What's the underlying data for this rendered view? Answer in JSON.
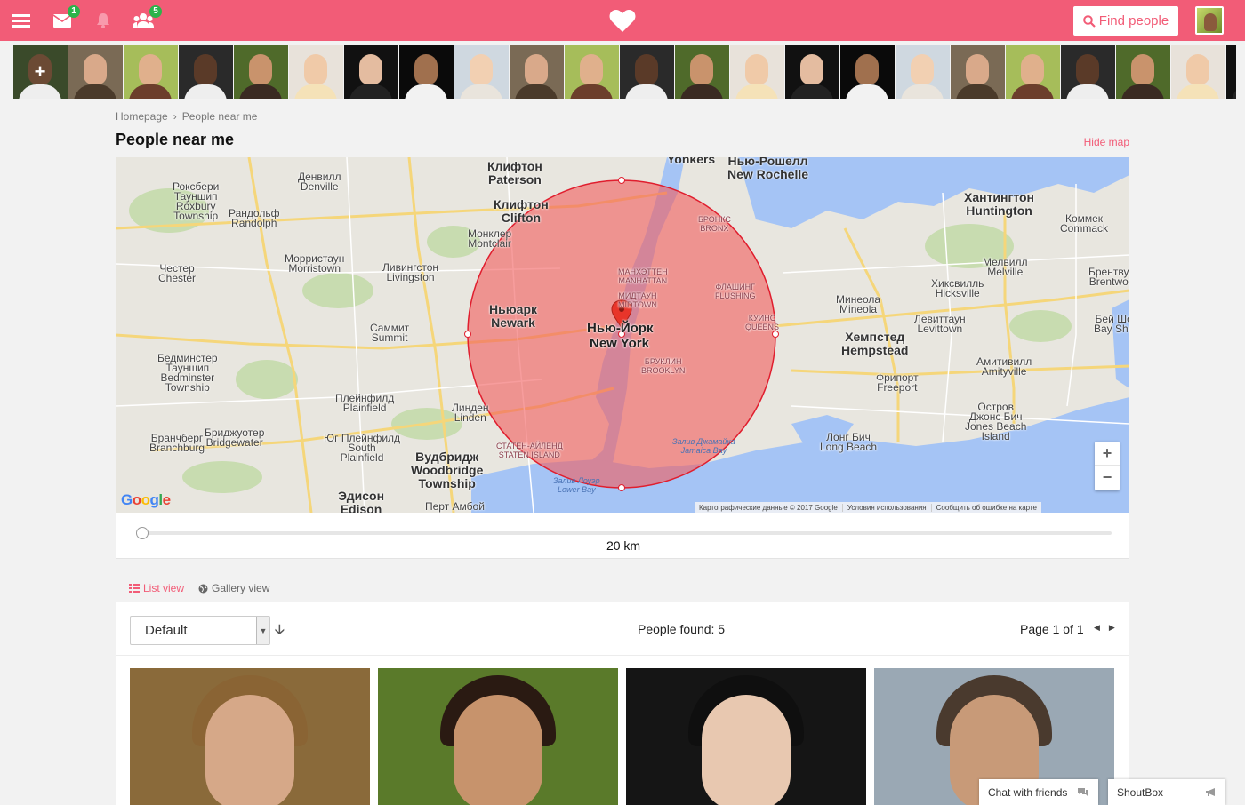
{
  "topbar": {
    "messages_badge": "1",
    "friends_badge": "5",
    "find_people_label": "Find people",
    "brand_color": "#f25c77"
  },
  "strip": {
    "thumbs": [
      {
        "bg": "#3a4a2a",
        "face": "#6b4a34",
        "body": "#eee"
      },
      {
        "bg": "#7a6a55",
        "face": "#d9a98a",
        "body": "#4a3a2a"
      },
      {
        "bg": "#a6bd5a",
        "face": "#e0b08c",
        "body": "#6c3e2c"
      },
      {
        "bg": "#2a2a2a",
        "face": "#5a3a28",
        "body": "#eeeeee"
      },
      {
        "bg": "#4f6a2a",
        "face": "#c9936c",
        "body": "#3a2a22"
      },
      {
        "bg": "#e8e2da",
        "face": "#f0caa8",
        "body": "#f5e2b8"
      },
      {
        "bg": "#111111",
        "face": "#e4bca0",
        "body": "#222"
      },
      {
        "bg": "#0a0a0a",
        "face": "#a0704e",
        "body": "#f2f2f2"
      },
      {
        "bg": "#cfd8e0",
        "face": "#f2d0b2",
        "body": "#e9e4dc"
      },
      {
        "bg": "#7a6a55",
        "face": "#d9a98a",
        "body": "#4a3a2a"
      },
      {
        "bg": "#a6bd5a",
        "face": "#e0b08c",
        "body": "#6c3e2c"
      },
      {
        "bg": "#2a2a2a",
        "face": "#5a3a28",
        "body": "#eeeeee"
      },
      {
        "bg": "#4f6a2a",
        "face": "#c9936c",
        "body": "#3a2a22"
      },
      {
        "bg": "#e8e2da",
        "face": "#f0caa8",
        "body": "#f5e2b8"
      },
      {
        "bg": "#111111",
        "face": "#e4bca0",
        "body": "#222"
      },
      {
        "bg": "#0a0a0a",
        "face": "#a0704e",
        "body": "#f2f2f2"
      },
      {
        "bg": "#cfd8e0",
        "face": "#f2d0b2",
        "body": "#e9e4dc"
      },
      {
        "bg": "#7a6a55",
        "face": "#d9a98a",
        "body": "#4a3a2a"
      },
      {
        "bg": "#a6bd5a",
        "face": "#e0b08c",
        "body": "#6c3e2c"
      },
      {
        "bg": "#2a2a2a",
        "face": "#5a3a28",
        "body": "#eeeeee"
      },
      {
        "bg": "#4f6a2a",
        "face": "#c9936c",
        "body": "#3a2a22"
      },
      {
        "bg": "#e8e2da",
        "face": "#f0caa8",
        "body": "#f5e2b8"
      },
      {
        "bg": "#111111",
        "face": "#e4bca0",
        "body": "#222"
      }
    ]
  },
  "breadcrumb": {
    "home": "Homepage",
    "separator": "›",
    "current": "People near me"
  },
  "page": {
    "title": "People near me",
    "hide_map": "Hide map"
  },
  "map": {
    "labels": {
      "paterson": "Клифтон\nPaterson",
      "yonkers": "Yonkers",
      "new_rochelle": "Нью-Рошелл\nNew Rochelle",
      "denville": "Денвилл\nDenville",
      "roxbury": "Роксбери\nТауншип\nRoxbury\nTownship",
      "randolph": "Рандольф\nRandolph",
      "clifton": "Клифтон\nClifton",
      "montclair": "Монклер\nMontclair",
      "morristown": "Морристаун\nMorristown",
      "livingston": "Ливингстон\nLivingston",
      "chester": "Честер\nChester",
      "summit": "Саммит\nSummit",
      "newark": "Ньюарк\nNewark",
      "ny_ru": "Нью-Йорк",
      "ny_en": "New York",
      "manhattan": "МАНХЭТТЕН\nMANHATTAN",
      "midtown": "МИДТАУН\nMIDTOWN",
      "bronx": "БРОНКС\nBRONX",
      "flushing": "ФЛАШИНГ\nFLUSHING",
      "queens": "КУИНС\nQUEENS",
      "brooklyn": "БРУКЛИН\nBROOKLYN",
      "bedminster": "Бедминстер\nТауншип\nBedminster\nTownship",
      "plainfield": "Плейнфилд\nPlainfield",
      "linden": "Линден\nLinden",
      "staten": "СТАТЕН-АЙЛЕНД\nSTATEN ISLAND",
      "branchburg": "Бранчберг\nBranchburg",
      "bridgewater": "Бриджуотер\nBridgewater",
      "south_plainfield": "Юг Плейнфилд\nSouth\nPlainfield",
      "woodbridge": "Вудбридж\nWoodbridge\nTownship",
      "edison": "Эдисон\nEdison",
      "perth": "Перт Амбой",
      "huntington": "Хантингтон\nHuntington",
      "commack": "Коммек\nCommack",
      "melville": "Мелвилл\nMelville",
      "hicksville": "Хиксвилль\nHicksville",
      "mineola": "Минеола\nMineola",
      "levittown": "Левиттаун\nLevittown",
      "hempstead": "Хемпстед\nHempstead",
      "freeport": "Фрипорт\nFreeport",
      "amityville": "Амитивилл\nAmityville",
      "long_beach": "Лонг Бич\nLong Beach",
      "jones_beach": "Остров\nДжонс Бич\nJones Beach\nIsland",
      "jamaica_bay": "Залив Джамайка\nJamaica Bay",
      "lower_bay": "Залив Лоуэр\nLower Bay",
      "brentwood": "Брентву\nBrentwo",
      "bay_shore": "Бей Шо\nBay Sho"
    },
    "zoom_in": "+",
    "zoom_out": "−",
    "google": "Google",
    "attrib_data": "Картографические данные © 2017 Google",
    "attrib_terms": "Условия использования",
    "attrib_report": "Сообщить об ошибке на карте",
    "circle_color": "#f25c5c"
  },
  "radius": {
    "value_label": "20 km",
    "level": 0.0
  },
  "views": {
    "list": "List view",
    "gallery": "Gallery view"
  },
  "results": {
    "sort_value": "Default",
    "found_label": "People found:",
    "found_count": "5",
    "page_label": "Page 1 of 1",
    "cards": [
      {
        "bg": "#8a6a3a",
        "face": "#d6a888",
        "hair": "#8a6434"
      },
      {
        "bg": "#5a7a2a",
        "face": "#c7936c",
        "hair": "#2a1a12"
      },
      {
        "bg": "#151515",
        "face": "#e8c8b0",
        "hair": "#0f0f0f"
      },
      {
        "bg": "#9aa8b4",
        "face": "#c89a78",
        "hair": "#4a3a2e"
      }
    ]
  },
  "footer": {
    "chat_label": "Chat with friends",
    "shoutbox_label": "ShoutBox"
  }
}
